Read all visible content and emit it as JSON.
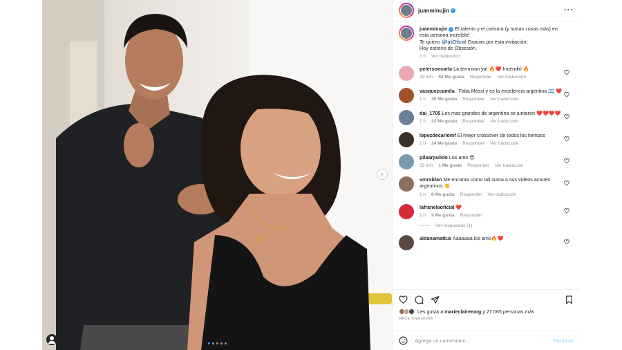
{
  "post": {
    "author": "juanminujin",
    "caption": {
      "username": "juanminujin",
      "line1": "El talento y el carisma (y tantas cosas más) en esta persona increíble!",
      "line2_prefix": "Te quiero ",
      "mention": "@laliOficial",
      "line2_suffix": " Gracias por esta invitación.",
      "line3": "Hoy estreno de Obsesión.",
      "time": "1 h",
      "see_translation": "Ver traducción"
    },
    "media": {
      "slide_count": 5,
      "current_slide": 1
    }
  },
  "comments": [
    {
      "username": "petersoncarla",
      "text": "La terminan ya! 🔥❤️ Incendió 🔥",
      "time": "29 min",
      "likes": "68 Me gusta",
      "reply": "Responder",
      "translate": "Ver traducción",
      "avatar_color": "#e9a8b0"
    },
    {
      "username": "vasquezcamila_",
      "text": "Falta Messi y es la excelencia argentina 🇦🇷 ❤️",
      "time": "1 h",
      "likes": "35 Me gusta",
      "reply": "Responder",
      "translate": "Ver traducción",
      "avatar_color": "#a0522d"
    },
    {
      "username": "dai_1705",
      "text": "Los mas grandes de argentina se juntaron ❤️❤️❤️❤️",
      "time": "1 h",
      "likes": "32 Me gusta",
      "reply": "Responder",
      "translate": "Ver traducción",
      "avatar_color": "#6b7f96"
    },
    {
      "username": "lopezdecarlomf",
      "text": "El mejor crossover de todos los tiempos",
      "time": "1 h",
      "likes": "24 Me gusta",
      "reply": "Responder",
      "translate": "Ver traducción",
      "avatar_color": "#3b3028"
    },
    {
      "username": "pilaarpulido",
      "text": "Los amo 😍",
      "time": "59 min",
      "likes": "1 Me gusta",
      "reply": "Responder",
      "translate": "Ver traducción",
      "avatar_color": "#7a9ab0"
    },
    {
      "username": "vmroldan",
      "text": "Me encanta como lali suma a sus videos actores argentinos 👏",
      "time": "1 h",
      "likes": "8 Me gusta",
      "reply": "Responder",
      "translate": "Ver traducción",
      "avatar_color": "#8c6f63"
    },
    {
      "username": "lafranelaoficial",
      "text": "❤️",
      "time": "1 h",
      "likes": "9 Me gusta",
      "reply": "Responder",
      "translate": "",
      "avatar_color": "#d52b3a"
    },
    {
      "username": "aldanamattus",
      "text": "Aaaaaaa los amo🔥❤️",
      "time": "",
      "likes": "",
      "reply": "",
      "translate": "",
      "avatar_color": "#5a4a42"
    }
  ],
  "view_replies": "Ver respuestas (1)",
  "likes_summary": {
    "prefix": "Les gusta a ",
    "user": "marieclaireargentina",
    "user_display": "marieclaireearg",
    "suffix": " y 27.065 personas más"
  },
  "post_time": "HACE UNA HORA",
  "add_comment": {
    "placeholder": "Agrega un comentario...",
    "publish_label": "Publicar"
  },
  "colors": {
    "accent": "#3897f0",
    "link": "#00376b",
    "muted": "#8e8e8e"
  }
}
